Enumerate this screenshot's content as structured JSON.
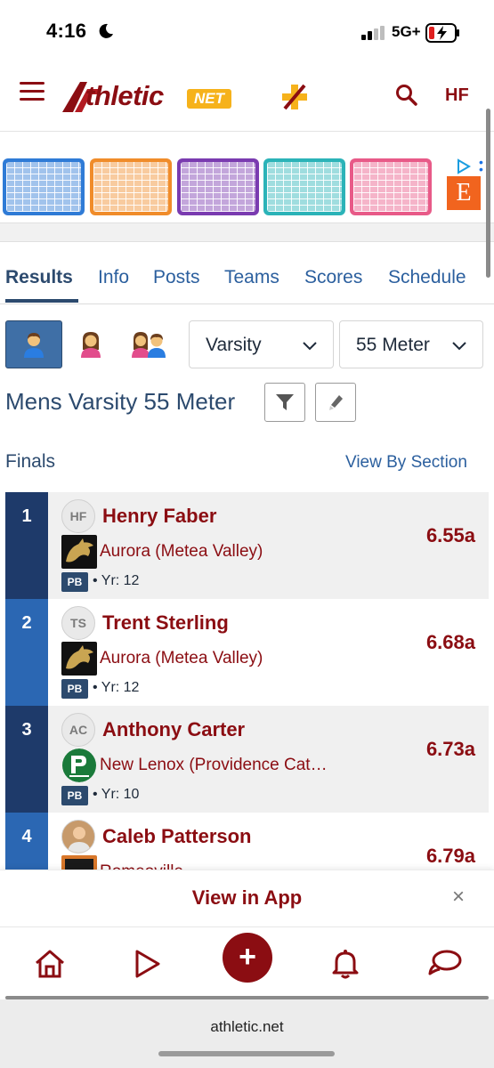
{
  "status_bar": {
    "time": "4:16",
    "network": "5G+"
  },
  "header": {
    "logo_main": "thletic",
    "logo_net": "NET",
    "user_initials": "HF"
  },
  "ad": {
    "brand_letter": "E"
  },
  "tabs": [
    {
      "label": "Results",
      "active": true
    },
    {
      "label": "Info"
    },
    {
      "label": "Posts"
    },
    {
      "label": "Teams"
    },
    {
      "label": "Scores"
    },
    {
      "label": "Schedule"
    }
  ],
  "filters": {
    "level": "Varsity",
    "event": "55 Meter"
  },
  "event_title": "Mens Varsity 55 Meter",
  "section": {
    "label": "Finals",
    "view_by": "View By Section"
  },
  "results": [
    {
      "place": "1",
      "initials": "HF",
      "name": "Henry Faber",
      "team": "Aurora (Metea Valley)",
      "pb": "PB",
      "year": "Yr: 12",
      "mark": "6.55a"
    },
    {
      "place": "2",
      "initials": "TS",
      "name": "Trent Sterling",
      "team": "Aurora (Metea Valley)",
      "pb": "PB",
      "year": "Yr: 12",
      "mark": "6.68a"
    },
    {
      "place": "3",
      "initials": "AC",
      "name": "Anthony Carter",
      "team": "New Lenox (Providence Cat…",
      "pb": "PB",
      "year": "Yr: 10",
      "mark": "6.73a"
    },
    {
      "place": "4",
      "initials": "",
      "name": "Caleb Patterson",
      "team": "Romeoville",
      "pb": "",
      "year": "",
      "mark": "6.79a"
    }
  ],
  "app_banner": {
    "label": "View in App",
    "close": "×"
  },
  "browser": {
    "url": "athletic.net"
  },
  "colors": {
    "brand": "#8b0d12",
    "navy": "#2c4a6e",
    "place_dark": "#1e3a6a",
    "place_blue": "#2b67b3",
    "accent_gold": "#f6b21b"
  }
}
